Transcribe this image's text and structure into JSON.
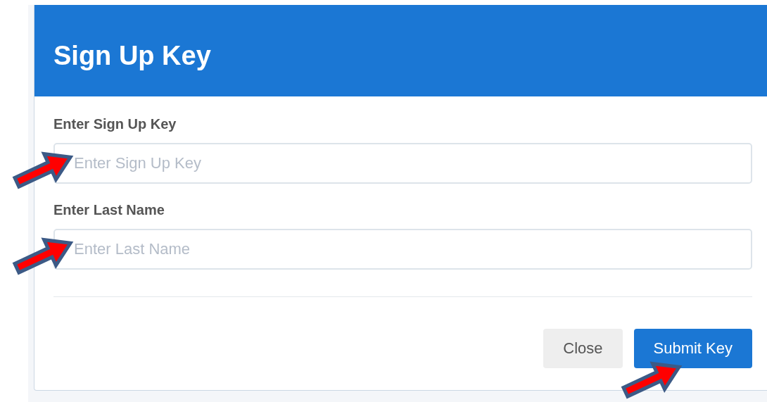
{
  "dialog": {
    "title": "Sign Up Key",
    "fields": [
      {
        "label": "Enter Sign Up Key",
        "placeholder": "Enter Sign Up Key",
        "arrow": true
      },
      {
        "label": "Enter Last Name",
        "placeholder": "Enter Last Name",
        "arrow": true
      }
    ],
    "buttons": [
      {
        "label": "Close",
        "kind": "secondary",
        "arrow": false
      },
      {
        "label": "Submit Key",
        "kind": "primary",
        "arrow": true
      }
    ]
  }
}
